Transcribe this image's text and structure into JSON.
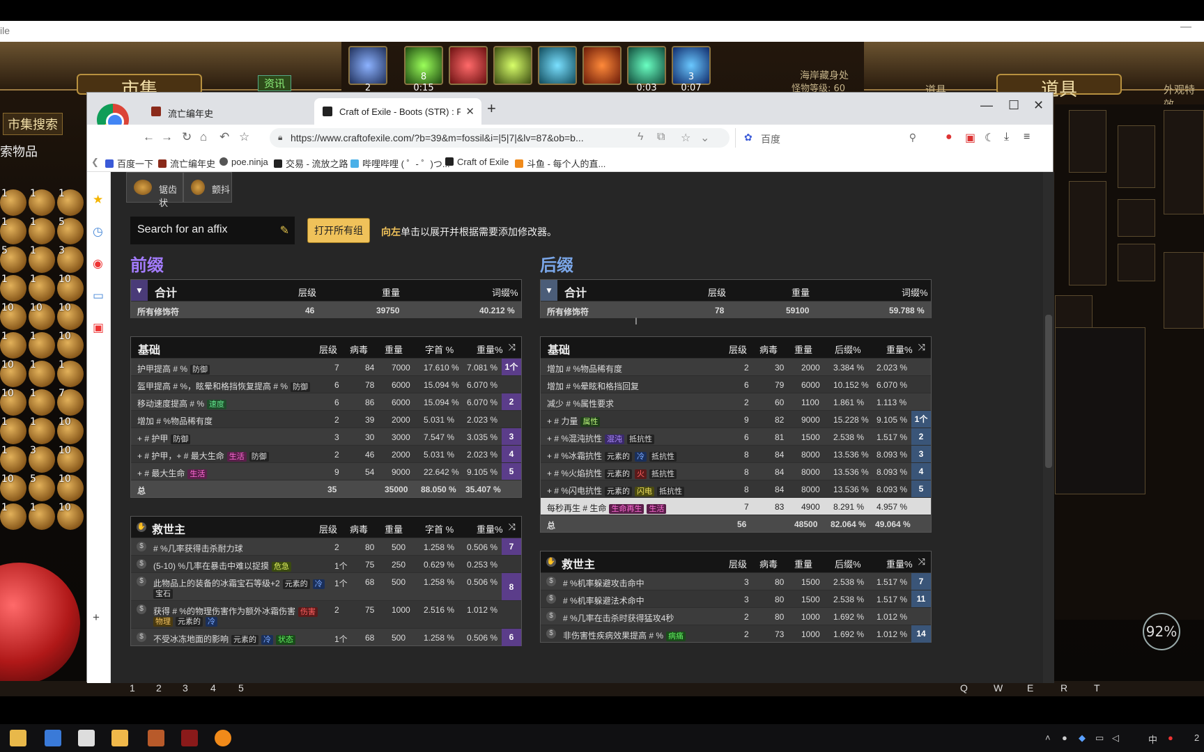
{
  "game": {
    "window_title_fragment": "ile",
    "left_banner": "市集",
    "right_banner": "道具",
    "market_search_btn": "市集搜索",
    "search_items_label": "索物品",
    "news_label": "资讯",
    "zone_name": "海岸藏身处",
    "monster_level": "怪物等级: 60",
    "right_tab_item": "道具",
    "right_tab_cosmetic": "外观特效",
    "skill_counts": [
      "2",
      "8",
      "",
      "",
      "",
      "",
      "",
      "3"
    ],
    "skill_timers": [
      "",
      "0:15",
      "",
      "",
      "",
      "",
      "0:03",
      "0:07"
    ],
    "es_percent": "92%",
    "hotbar_slots": [
      "1",
      "2",
      "3",
      "4",
      "5"
    ],
    "hotbar_keys": [
      "Q",
      "W",
      "E",
      "R",
      "T"
    ],
    "inventory_counts": [
      [
        "1",
        "1",
        "1"
      ],
      [
        "1",
        "1",
        "5"
      ],
      [
        "5",
        "1",
        "3"
      ],
      [
        "1",
        "1",
        "10"
      ],
      [
        "10",
        "10",
        "10"
      ],
      [
        "1",
        "1",
        "10"
      ],
      [
        "10",
        "1",
        "1"
      ],
      [
        "10",
        "1",
        "7"
      ],
      [
        "1",
        "1",
        "10"
      ],
      [
        "1",
        "3",
        "10"
      ],
      [
        "10",
        "5",
        "10"
      ],
      [
        "1",
        "1",
        "10"
      ]
    ]
  },
  "browser": {
    "tabs": [
      {
        "label": "流亡编年史",
        "active": false
      },
      {
        "label": "Craft of Exile - Boots (STR) : FC",
        "active": true
      }
    ],
    "new_tab": "+",
    "url": "https://www.craftofexile.com/?b=39&m=fossil&i=|5|7|&lv=87&ob=b...",
    "search_engine": "百度",
    "bookmarks": [
      "百度一下",
      "流亡编年史",
      "poe.ninja",
      "交易 - 流放之路",
      "哔哩哔哩 ( ゜- ゜)つ...",
      "Craft of Exile",
      "斗鱼 - 每个人的直..."
    ]
  },
  "page": {
    "fossils": [
      "锯齿状",
      "颤抖"
    ],
    "affix_search_placeholder": "Search for an affix",
    "open_all_btn": "打开所有组",
    "hint_bold": "向左",
    "hint_text": "单击以展开并根据需要添加修改器。",
    "prefix": {
      "title": "前缀",
      "total": {
        "label": "合计",
        "col_tier": "层级",
        "col_weight": "重量",
        "col_pct": "词缀%",
        "row_label": "所有修饰符",
        "tier": "46",
        "weight": "39750",
        "pct": "40.212  %"
      },
      "basic": {
        "title": "基础",
        "cols": [
          "层级",
          "病毒",
          "重量",
          "字首 %",
          "重量%"
        ],
        "rows": [
          {
            "name": "护甲提高 # %",
            "tags": [
              [
                "防御",
                ""
              ]
            ],
            "lvl": "7",
            "ilvl": "84",
            "w": "7000",
            "p1": "17.610  %",
            "p2": "7.081  %",
            "g": "1个"
          },
          {
            "name": "盔甲提高 # %，眩晕和格挡恢复提高 # %",
            "tags": [
              [
                "防御",
                ""
              ]
            ],
            "lvl": "6",
            "ilvl": "78",
            "w": "6000",
            "p1": "15.094  %",
            "p2": "6.070  %",
            "g": ""
          },
          {
            "name": "移动速度提高 # %",
            "tags": [
              [
                "速度",
                "spd"
              ]
            ],
            "lvl": "6",
            "ilvl": "86",
            "w": "6000",
            "p1": "15.094  %",
            "p2": "6.070  %",
            "g": "2"
          },
          {
            "name": "增加 # %物品稀有度",
            "tags": [],
            "lvl": "2",
            "ilvl": "39",
            "w": "2000",
            "p1": "5.031  %",
            "p2": "2.023  %",
            "g": ""
          },
          {
            "name": "+ # 护甲",
            "tags": [
              [
                "防御",
                ""
              ]
            ],
            "lvl": "3",
            "ilvl": "30",
            "w": "3000",
            "p1": "7.547  %",
            "p2": "3.035  %",
            "g": "3"
          },
          {
            "name": "+ # 护甲，+ # 最大生命",
            "tags": [
              [
                "生活",
                "life"
              ],
              [
                "防御",
                ""
              ]
            ],
            "lvl": "2",
            "ilvl": "46",
            "w": "2000",
            "p1": "5.031  %",
            "p2": "2.023  %",
            "g": "4"
          },
          {
            "name": "+ # 最大生命",
            "tags": [
              [
                "生活",
                "life"
              ]
            ],
            "lvl": "9",
            "ilvl": "54",
            "w": "9000",
            "p1": "22.642  %",
            "p2": "9.105  %",
            "g": "5"
          }
        ],
        "sum": {
          "name": "总",
          "lvl": "35",
          "w": "35000",
          "p1": "88.050  %",
          "p2": "35.407  %"
        }
      },
      "redeemer": {
        "title": "救世主",
        "cols": [
          "层级",
          "病毒",
          "重量",
          "字首 %",
          "重量%"
        ],
        "rows": [
          {
            "name": "# %几率获得击杀耐力球",
            "tags": [],
            "lvl": "2",
            "ilvl": "80",
            "w": "500",
            "p1": "1.258  %",
            "p2": "0.506  %",
            "g": "7"
          },
          {
            "name": "(5-10) %几率在暴击中难以捉摸",
            "tags": [
              [
                "危急",
                "crit"
              ]
            ],
            "lvl": "1个",
            "ilvl": "75",
            "w": "250",
            "p1": "0.629  %",
            "p2": "0.253  %",
            "g": ""
          },
          {
            "name": "此物品上的装备的冰霜宝石等级+2",
            "tags": [
              [
                "元素的",
                ""
              ],
              [
                "冷",
                "cold"
              ]
            ],
            "line2": [
              [
                "宝石",
                ""
              ]
            ],
            "lvl": "1个",
            "ilvl": "68",
            "w": "500",
            "p1": "1.258  %",
            "p2": "0.506  %",
            "g": "8"
          },
          {
            "name": "获得 # %的物理伤害作为额外冰霜伤害",
            "tags": [
              [
                "伤害",
                "fire"
              ]
            ],
            "line2": [
              [
                "物理",
                "phys"
              ],
              [
                "元素的",
                ""
              ],
              [
                "冷",
                "cold"
              ]
            ],
            "lvl": "2",
            "ilvl": "75",
            "w": "1000",
            "p1": "2.516  %",
            "p2": "1.012  %",
            "g": ""
          },
          {
            "name": "不受冰冻地面的影响",
            "tags": [
              [
                "元素的",
                ""
              ],
              [
                "冷",
                "cold"
              ],
              [
                "状态",
                "ail"
              ]
            ],
            "lvl": "1个",
            "ilvl": "68",
            "w": "500",
            "p1": "1.258  %",
            "p2": "0.506  %",
            "g": "6"
          }
        ]
      }
    },
    "suffix": {
      "title": "后缀",
      "total": {
        "label": "合计",
        "col_tier": "层级",
        "col_weight": "重量",
        "col_pct": "词缀%",
        "row_label": "所有修饰符",
        "tier": "78",
        "weight": "59100",
        "pct": "59.788  %"
      },
      "basic": {
        "title": "基础",
        "cols": [
          "层级",
          "病毒",
          "重量",
          "后缀%",
          "重量%"
        ],
        "rows": [
          {
            "name": "增加 # %物品稀有度",
            "tags": [],
            "lvl": "2",
            "ilvl": "30",
            "w": "2000",
            "p1": "3.384  %",
            "p2": "2.023  %",
            "g": ""
          },
          {
            "name": "增加 # %晕眩和格挡回复",
            "tags": [],
            "lvl": "6",
            "ilvl": "79",
            "w": "6000",
            "p1": "10.152  %",
            "p2": "6.070  %",
            "g": ""
          },
          {
            "name": "减少 # %属性要求",
            "tags": [],
            "lvl": "2",
            "ilvl": "60",
            "w": "1100",
            "p1": "1.861  %",
            "p2": "1.113  %",
            "g": ""
          },
          {
            "name": "+ # 力量",
            "tags": [
              [
                "属性",
                "attr"
              ]
            ],
            "lvl": "9",
            "ilvl": "82",
            "w": "9000",
            "p1": "15.228  %",
            "p2": "9.105  %",
            "g": "1个"
          },
          {
            "name": "+ # %混沌抗性",
            "tags": [
              [
                "混沌",
                "chaos"
              ],
              [
                "抵抗性",
                ""
              ]
            ],
            "lvl": "6",
            "ilvl": "81",
            "w": "1500",
            "p1": "2.538  %",
            "p2": "1.517  %",
            "g": "2"
          },
          {
            "name": "+ # %冰霜抗性",
            "tags": [
              [
                "元素的",
                ""
              ],
              [
                "冷",
                "cold"
              ],
              [
                "抵抗性",
                ""
              ]
            ],
            "lvl": "8",
            "ilvl": "84",
            "w": "8000",
            "p1": "13.536  %",
            "p2": "8.093  %",
            "g": "3"
          },
          {
            "name": "+ # %火焰抗性",
            "tags": [
              [
                "元素的",
                ""
              ],
              [
                "火",
                "fire"
              ],
              [
                "抵抗性",
                ""
              ]
            ],
            "lvl": "8",
            "ilvl": "84",
            "w": "8000",
            "p1": "13.536  %",
            "p2": "8.093  %",
            "g": "4"
          },
          {
            "name": "+ # %闪电抗性",
            "tags": [
              [
                "元素的",
                ""
              ],
              [
                "闪电",
                "light"
              ],
              [
                "抵抗性",
                ""
              ]
            ],
            "lvl": "8",
            "ilvl": "84",
            "w": "8000",
            "p1": "13.536  %",
            "p2": "8.093  %",
            "g": "5"
          },
          {
            "name": "每秒再生 # 生命",
            "tags": [
              [
                "生命再生",
                "life"
              ],
              [
                "生活",
                "life"
              ]
            ],
            "lvl": "7",
            "ilvl": "83",
            "w": "4900",
            "p1": "8.291  %",
            "p2": "4.957  %",
            "g": "",
            "hl": true
          }
        ],
        "sum": {
          "name": "总",
          "lvl": "56",
          "w": "48500",
          "p1": "82.064  %",
          "p2": "49.064  %"
        }
      },
      "redeemer": {
        "title": "救世主",
        "cols": [
          "层级",
          "病毒",
          "重量",
          "后缀%",
          "重量%"
        ],
        "rows": [
          {
            "name": "# %机率躲避攻击命中",
            "tags": [],
            "lvl": "3",
            "ilvl": "80",
            "w": "1500",
            "p1": "2.538  %",
            "p2": "1.517  %",
            "g": "7"
          },
          {
            "name": "# %机率躲避法术命中",
            "tags": [],
            "lvl": "3",
            "ilvl": "80",
            "w": "1500",
            "p1": "2.538  %",
            "p2": "1.517  %",
            "g": "11"
          },
          {
            "name": "# %几率在击杀时获得猛攻4秒",
            "tags": [],
            "lvl": "2",
            "ilvl": "80",
            "w": "1000",
            "p1": "1.692  %",
            "p2": "1.012  %",
            "g": ""
          },
          {
            "name": "非伤害性疾病效果提高 # %",
            "tags": [
              [
                "病痛",
                "ail"
              ]
            ],
            "lvl": "2",
            "ilvl": "73",
            "w": "1000",
            "p1": "1.692  %",
            "p2": "1.012  %",
            "g": "14"
          }
        ]
      }
    }
  },
  "taskbar": {
    "tray_ime": "中",
    "clock_fragment": "2"
  },
  "colors": {
    "prefix_accent": "#5b3d8a",
    "suffix_accent": "#3a5578",
    "page_bg": "#262626",
    "button_gold": "#f0c25a"
  }
}
